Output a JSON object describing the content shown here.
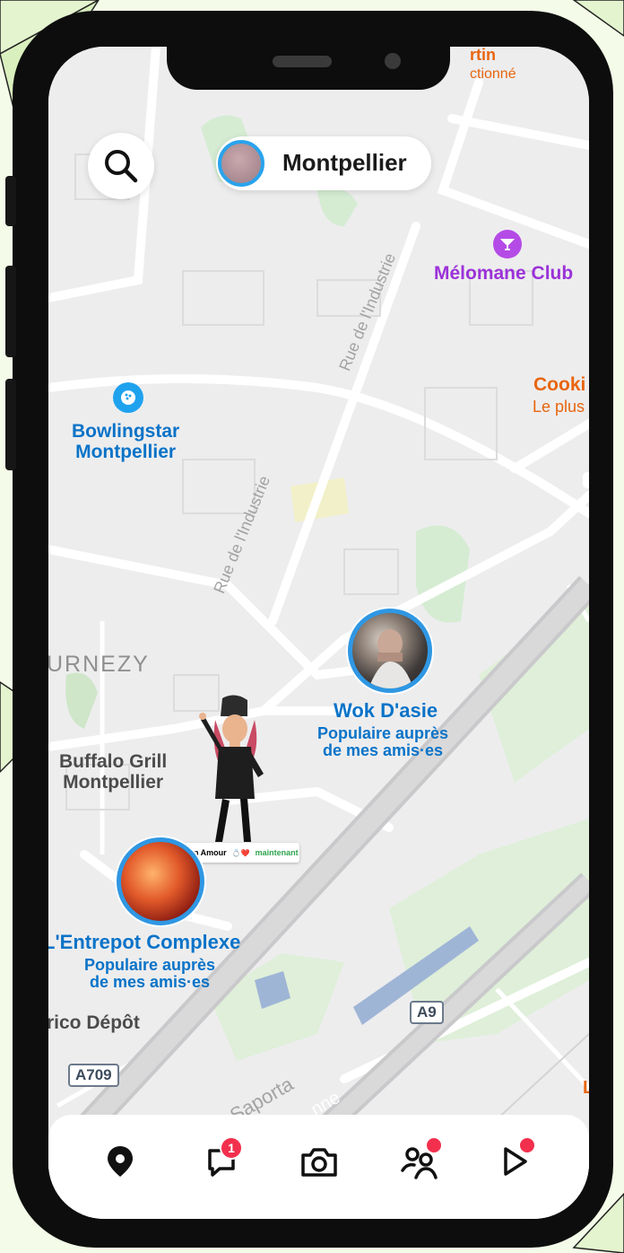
{
  "colors": {
    "map_bg": "#ededee",
    "accent_blue": "#2f97e3",
    "badge_red": "#f2304d",
    "poi_purple": "#9b32d8",
    "poi_orange": "#e8650f"
  },
  "header": {
    "city_name": "Montpellier",
    "search_icon": "search-icon"
  },
  "map": {
    "roads": [
      "Rue de l'Industrie",
      "Rue de l'Industrie",
      "de Saporta",
      "nne"
    ],
    "district": "URNEZY",
    "places": [
      {
        "name": "Mélomane Club",
        "icon": "cocktail-icon"
      },
      {
        "name": "Bowlingstar\nMontpellier",
        "icon": "bowling-icon"
      },
      {
        "name": "Buffalo Grill\nMontpellier"
      },
      {
        "name": "rico Dépôt"
      },
      {
        "name": "Cooki",
        "sub": "Le plus"
      },
      {
        "name": "rtin",
        "sub": "ctionné"
      }
    ],
    "highways": [
      "A9",
      "A709"
    ],
    "edge_letter": "L"
  },
  "friends": [
    {
      "place": "Wok D'asie",
      "subtitle": "Populaire auprès\nde mes amis·es"
    },
    {
      "place": "L'Entrepot Complexe",
      "subtitle": "Populaire auprès\nde mes amis·es"
    }
  ],
  "bitmoji": {
    "name": "Mon Amour",
    "emoji": "💍❤️",
    "status": "maintenant"
  },
  "nav": {
    "items": [
      {
        "name": "map",
        "icon": "map-pin-icon"
      },
      {
        "name": "chat",
        "icon": "chat-icon",
        "badge": "1"
      },
      {
        "name": "camera",
        "icon": "camera-icon"
      },
      {
        "name": "friends",
        "icon": "friends-icon"
      },
      {
        "name": "stories",
        "icon": "play-icon"
      }
    ]
  }
}
